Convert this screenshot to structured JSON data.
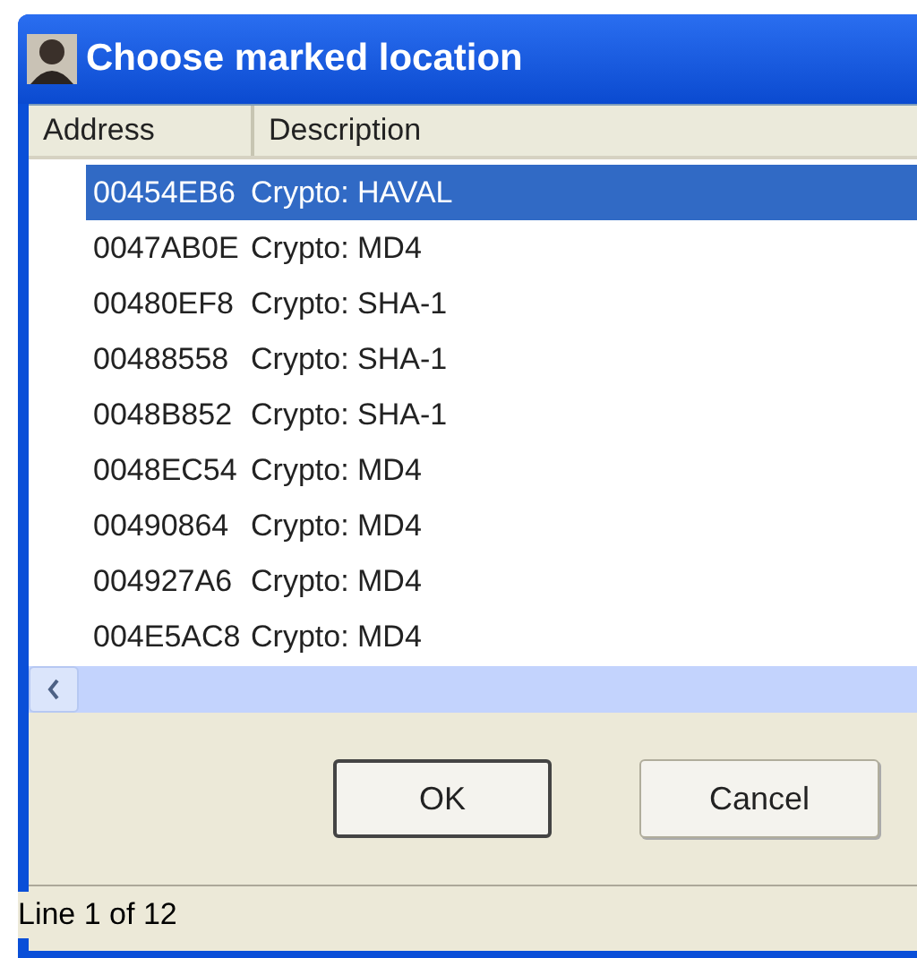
{
  "window": {
    "title": "Choose marked location"
  },
  "table": {
    "columns": [
      "Address",
      "Description"
    ],
    "rows": [
      {
        "address": "00454EB6",
        "description": "Crypto: HAVAL",
        "selected": true
      },
      {
        "address": "0047AB0E",
        "description": "Crypto: MD4",
        "selected": false
      },
      {
        "address": "00480EF8",
        "description": "Crypto: SHA-1",
        "selected": false
      },
      {
        "address": "00488558",
        "description": "Crypto: SHA-1",
        "selected": false
      },
      {
        "address": "0048B852",
        "description": "Crypto: SHA-1",
        "selected": false
      },
      {
        "address": "0048EC54",
        "description": "Crypto: MD4",
        "selected": false
      },
      {
        "address": "00490864",
        "description": "Crypto: MD4",
        "selected": false
      },
      {
        "address": "004927A6",
        "description": "Crypto: MD4",
        "selected": false
      },
      {
        "address": "004E5AC8",
        "description": "Crypto: MD4",
        "selected": false
      }
    ]
  },
  "buttons": [
    {
      "label": "OK",
      "default": true
    },
    {
      "label": "Cancel",
      "default": false
    }
  ],
  "status_bar": "Line 1 of 12"
}
